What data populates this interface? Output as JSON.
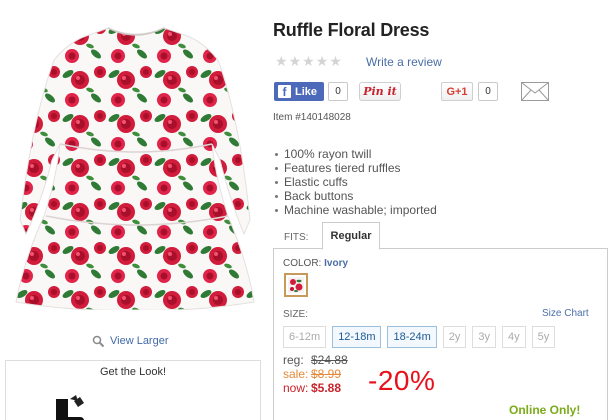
{
  "product": {
    "title": "Ruffle Floral Dress",
    "item_number": "Item #140148028",
    "rating_stars": 0,
    "write_review_label": "Write a review",
    "features": [
      "100% rayon twill",
      "Features tiered ruffles",
      "Elastic cuffs",
      "Back buttons",
      "Machine washable; imported"
    ]
  },
  "image": {
    "view_larger_label": "View Larger",
    "get_the_look_label": "Get the Look!"
  },
  "social": {
    "fb_like_label": "Like",
    "fb_count": "0",
    "pinit_label": "Pin it",
    "gplus_label": "G+1",
    "gplus_count": "0"
  },
  "fits": {
    "label": "FITS:",
    "selected_tab": "Regular"
  },
  "color": {
    "label": "COLOR:",
    "selected": "Ivory"
  },
  "size": {
    "label": "SIZE:",
    "chart_label": "Size Chart",
    "options": [
      {
        "label": "6-12m",
        "available": false
      },
      {
        "label": "12-18m",
        "available": true
      },
      {
        "label": "18-24m",
        "available": true
      },
      {
        "label": "2y",
        "available": false
      },
      {
        "label": "3y",
        "available": false
      },
      {
        "label": "4y",
        "available": false
      },
      {
        "label": "5y",
        "available": false
      }
    ]
  },
  "pricing": {
    "reg_label": "reg:",
    "reg_price": "$24.88",
    "sale_label": "sale:",
    "sale_price": "$8.99",
    "now_label": "now:",
    "now_price": "$5.88",
    "discount": "-20%",
    "online_only": "Online Only!"
  },
  "colors": {
    "link": "#4a6ea8",
    "sale_orange": "#e58a3a",
    "now_red": "#c8232c",
    "discount_red": "#e8101a",
    "online_green": "#7cab1a",
    "facebook_blue": "#4c69ba"
  }
}
